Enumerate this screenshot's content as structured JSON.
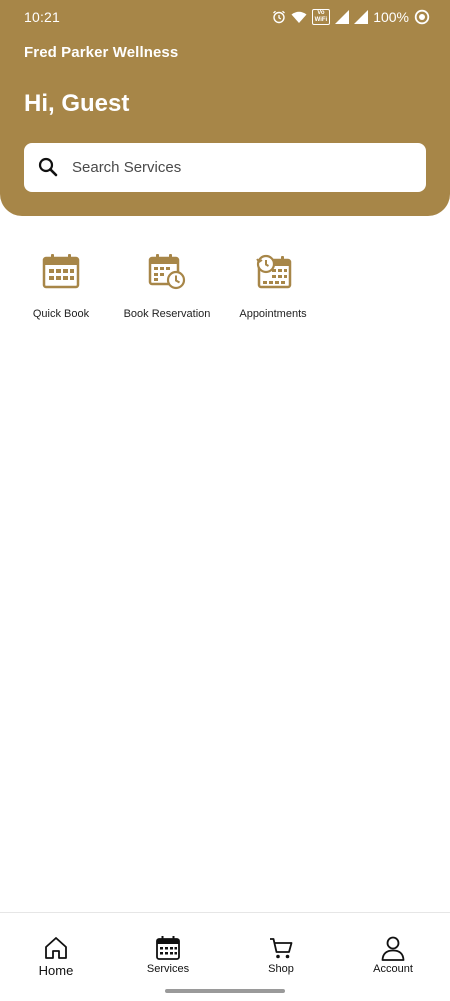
{
  "status_bar": {
    "time": "10:21",
    "volte_top": "Vo",
    "volte_bottom": "WiFi",
    "battery": "100%"
  },
  "header": {
    "brand": "Fred Parker Wellness",
    "greeting": "Hi, Guest"
  },
  "search": {
    "placeholder": "Search Services",
    "icon": "search-icon"
  },
  "quick_actions": [
    {
      "label": "Quick Book",
      "icon": "calendar-icon"
    },
    {
      "label": "Book Reservation",
      "icon": "calendar-clock-icon"
    },
    {
      "label": "Appointments",
      "icon": "calendar-history-icon"
    }
  ],
  "bottom_nav": [
    {
      "label": "Home",
      "icon": "home-icon"
    },
    {
      "label": "Services",
      "icon": "calendar-icon"
    },
    {
      "label": "Shop",
      "icon": "cart-icon"
    },
    {
      "label": "Account",
      "icon": "user-icon"
    }
  ],
  "colors": {
    "brand_gold": "#a78648",
    "text_dark": "#111111",
    "background": "#ffffff"
  }
}
